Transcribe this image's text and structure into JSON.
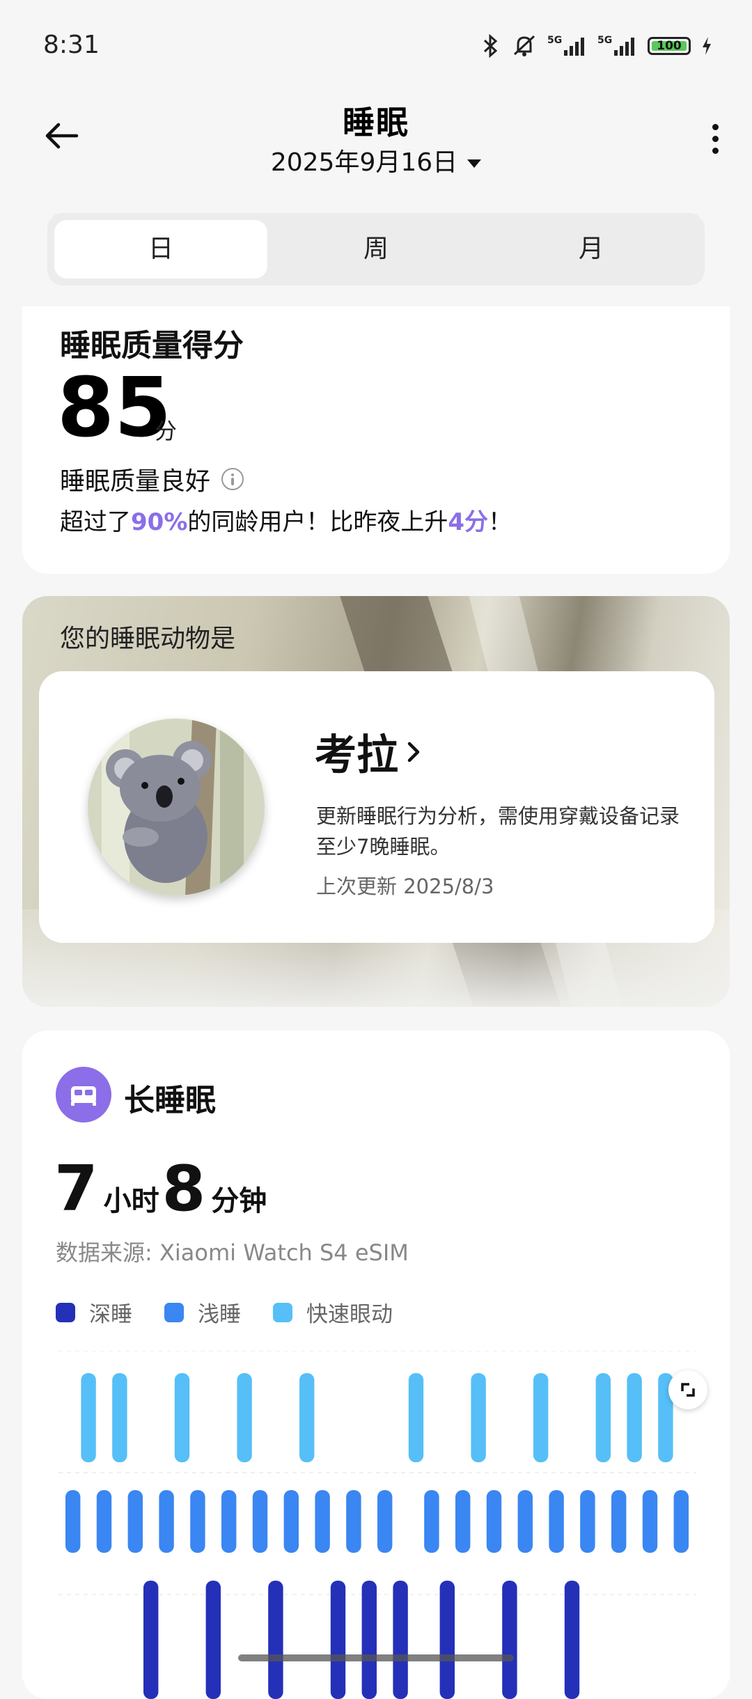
{
  "status_bar": {
    "time": "8:31",
    "battery": "100",
    "net1": "5G",
    "net2": "5G"
  },
  "header": {
    "title": "睡眠",
    "date": "2025年9月16日"
  },
  "tabs": [
    {
      "label": "日",
      "active": true
    },
    {
      "label": "周",
      "active": false
    },
    {
      "label": "月",
      "active": false
    }
  ],
  "score": {
    "title": "睡眠质量得分",
    "value": "85",
    "unit": "分",
    "quality": "睡眠质量良好",
    "compare_prefix": "超过了",
    "percent": "90%",
    "compare_mid": "的同龄用户！比昨夜上升",
    "delta": "4分",
    "compare_suffix": "！"
  },
  "animal": {
    "heading": "您的睡眠动物是",
    "name": "考拉",
    "description": "更新睡眠行为分析，需使用穿戴设备记录至少7晚睡眠。",
    "updated": "上次更新 2025/8/3"
  },
  "long_sleep": {
    "title": "长睡眠",
    "hours": "7",
    "hours_unit": "小时",
    "minutes": "8",
    "minutes_unit": "分钟",
    "source": "数据来源: Xiaomi Watch S4 eSIM",
    "legend": [
      {
        "label": "深睡",
        "color": "#2430b8"
      },
      {
        "label": "浅睡",
        "color": "#3a86f2"
      },
      {
        "label": "快速眼动",
        "color": "#56bff7"
      }
    ]
  },
  "chart_data": {
    "type": "area",
    "levels": [
      "快速眼动",
      "浅睡",
      "深睡"
    ],
    "colors": {
      "快速眼动": "#56bff7",
      "浅睡": "#3a86f2",
      "深睡": "#2430b8"
    },
    "stages": [
      "浅睡",
      "快速眼动",
      "浅睡",
      "快速眼动",
      "浅睡",
      "深睡",
      "浅睡",
      "快速眼动",
      "浅睡",
      "深睡",
      "浅睡",
      "快速眼动",
      "浅睡",
      "深睡",
      "浅睡",
      "快速眼动",
      "浅睡",
      "深睡",
      "浅睡",
      "深睡",
      "浅睡",
      "深睡",
      "快速眼动",
      "浅睡",
      "深睡",
      "浅睡",
      "快速眼动",
      "浅睡",
      "深睡",
      "浅睡",
      "快速眼动",
      "浅睡",
      "深睡",
      "浅睡",
      "快速眼动",
      "浅睡",
      "快速眼动",
      "浅睡",
      "快速眼动",
      "浅睡"
    ],
    "grid": true
  }
}
